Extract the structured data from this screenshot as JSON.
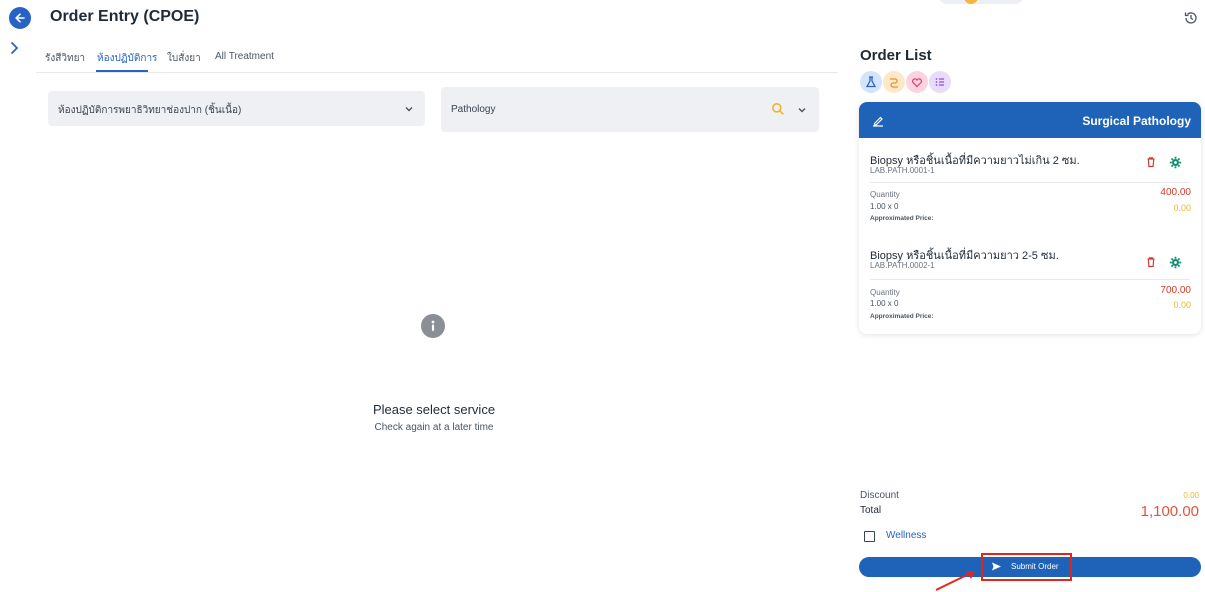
{
  "header": {
    "title": "Order Entry (CPOE)"
  },
  "tabs": [
    {
      "label": "รังสีวิทยา",
      "active": false
    },
    {
      "label": "ห้องปฏิบัติการ",
      "active": true
    },
    {
      "label": "ใบสั่งยา",
      "active": false
    },
    {
      "label": "All Treatment",
      "active": false
    }
  ],
  "filters": {
    "lab_select": "ห้องปฏิบัติการพยาธิวิทยาช่องปาก (ชิ้นเนื้อ)",
    "service_search": "Pathology"
  },
  "empty_state": {
    "title": "Please select service",
    "subtitle": "Check again at a later time"
  },
  "order_list": {
    "title": "Order List",
    "category_icons": [
      "lab-flask-icon",
      "route-icon",
      "heart-icon",
      "list-icon"
    ],
    "card_header": "Surgical Pathology",
    "items": [
      {
        "name": "Biopsy หรือชิ้นเนื้อที่มีความยาวไม่เกิน 2 ซม.",
        "code": "LAB.PATH.0001-1",
        "quantity_label": "Quantity",
        "quantity": "1.00 x 0",
        "price_label": "Approximated Price:",
        "price": "400.00",
        "sub_price": "0.00"
      },
      {
        "name": "Biopsy หรือชิ้นเนื้อที่มีความยาว 2-5 ซม.",
        "code": "LAB.PATH.0002-1",
        "quantity_label": "Quantity",
        "quantity": "1.00 x 0",
        "price_label": "Approximated Price:",
        "price": "700.00",
        "sub_price": "0.00"
      }
    ],
    "discount_label": "Discount",
    "discount": "0.00",
    "total_label": "Total",
    "total": "1,100.00",
    "wellness_label": "Wellness",
    "wellness_checked": false,
    "submit_label": "Submit Order"
  },
  "colors": {
    "primary": "#1e63b8",
    "price_red": "#d33a2c",
    "zero_yellow": "#f0b429",
    "total_orange": "#e0553a",
    "highlight_red": "#e3261c"
  }
}
